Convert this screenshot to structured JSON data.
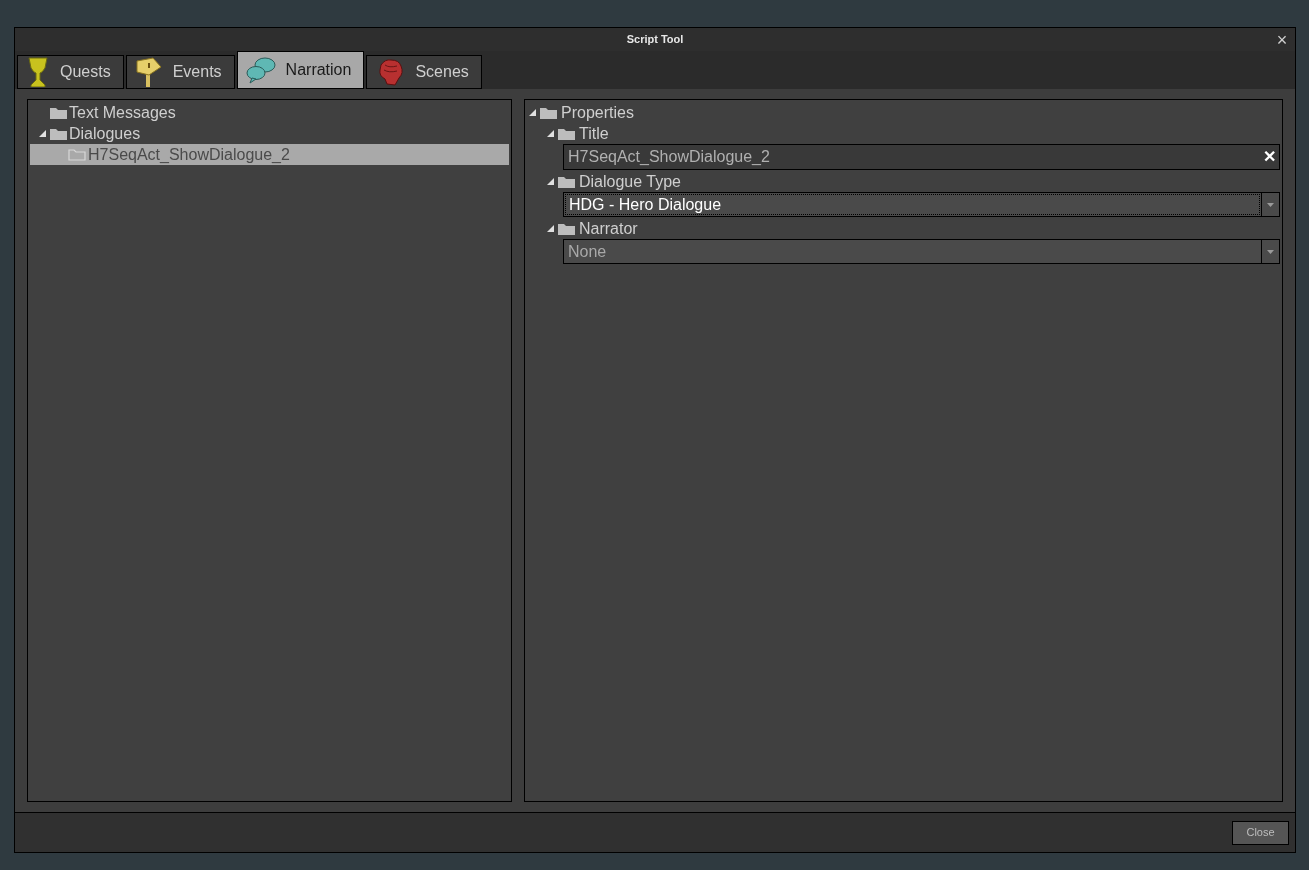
{
  "window": {
    "title": "Script Tool",
    "close": "×"
  },
  "tabs": [
    {
      "label": "Quests",
      "selected": false
    },
    {
      "label": "Events",
      "selected": false
    },
    {
      "label": "Narration",
      "selected": true
    },
    {
      "label": "Scenes",
      "selected": false
    }
  ],
  "tree": [
    {
      "label": "Text Messages",
      "selected": false
    },
    {
      "label": "Dialogues",
      "selected": false,
      "expanded": true,
      "children": [
        {
          "label": "H7SeqAct_ShowDialogue_2",
          "selected": true
        }
      ]
    }
  ],
  "properties": {
    "label": "Properties",
    "expanded": true,
    "items": [
      {
        "kind": "text",
        "label": "Title",
        "expanded": true,
        "value": "H7SeqAct_ShowDialogue_2",
        "focused": false,
        "clear": "✕"
      },
      {
        "kind": "dropdown",
        "label": "Dialogue Type",
        "expanded": true,
        "value": "HDG - Hero Dialogue",
        "focused": true
      },
      {
        "kind": "dropdown",
        "label": "Narrator",
        "expanded": true,
        "value": "None",
        "focused": false
      }
    ]
  },
  "buttons": [
    "Close"
  ]
}
